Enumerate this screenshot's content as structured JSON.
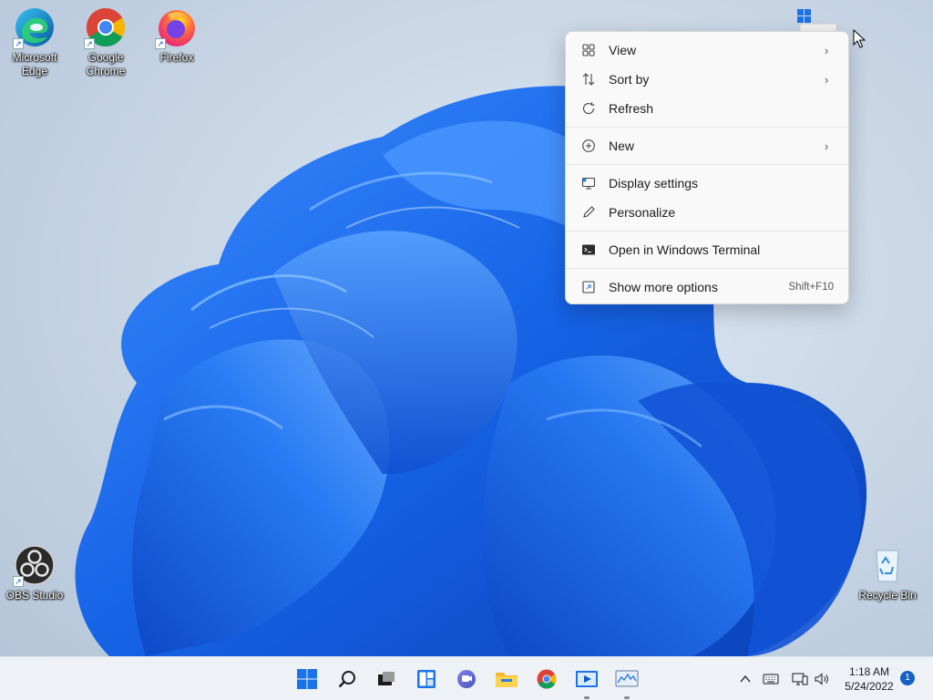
{
  "desktop_icons": [
    {
      "label": "Microsoft Edge",
      "icon": "edge-icon",
      "shortcut": true
    },
    {
      "label": "Google Chrome",
      "icon": "chrome-icon",
      "shortcut": true
    },
    {
      "label": "Firefox",
      "icon": "firefox-icon",
      "shortcut": true
    },
    {
      "label": "OBS Studio",
      "icon": "obs-icon",
      "shortcut": true
    },
    {
      "label": "Recycle Bin",
      "icon": "recycle-bin-icon",
      "shortcut": false
    }
  ],
  "context_menu": {
    "items": [
      {
        "label": "View",
        "icon": "grid-view-icon",
        "submenu": true
      },
      {
        "label": "Sort by",
        "icon": "sort-arrows-icon",
        "submenu": true
      },
      {
        "label": "Refresh",
        "icon": "refresh-icon",
        "submenu": false
      },
      {
        "label": "New",
        "icon": "plus-circle-icon",
        "submenu": true
      },
      {
        "label": "Display settings",
        "icon": "display-icon",
        "submenu": false
      },
      {
        "label": "Personalize",
        "icon": "pen-icon",
        "submenu": false
      },
      {
        "label": "Open in Windows Terminal",
        "icon": "terminal-icon",
        "submenu": false
      },
      {
        "label": "Show more options",
        "icon": "more-options-icon",
        "shortcut": "Shift+F10"
      }
    ]
  },
  "taskbar": {
    "pinned": [
      "start-icon",
      "search-icon",
      "task-view-icon",
      "widgets-icon",
      "chat-icon",
      "file-explorer-icon",
      "chrome-icon",
      "media-player-icon",
      "system-monitor-icon"
    ],
    "tray": [
      "chevron-up-icon",
      "keyboard-icon",
      "network-icon",
      "volume-icon"
    ],
    "clock_time": "1:18 AM",
    "clock_date": "5/24/2022",
    "notification_count": "1"
  },
  "colors": {
    "accent": "#0067c0",
    "wallpaper_bloom": "#1a6fe8",
    "menu_bg": "#f9f9f9"
  }
}
